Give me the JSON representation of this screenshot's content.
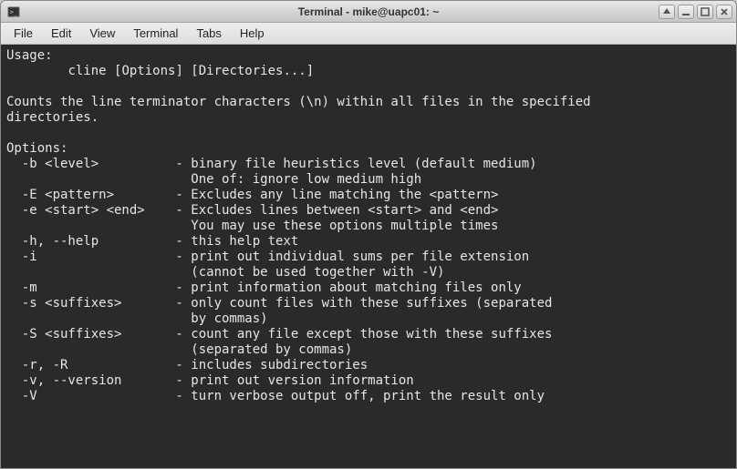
{
  "window": {
    "title": "Terminal - mike@uapc01: ~"
  },
  "menubar": {
    "items": [
      "File",
      "Edit",
      "View",
      "Terminal",
      "Tabs",
      "Help"
    ]
  },
  "terminal": {
    "lines": [
      "Usage:",
      "\tcline [Options] [Directories...]",
      "",
      "Counts the line terminator characters (\\n) within all files in the specified",
      "directories.",
      "",
      "Options:",
      "  -b <level>          - binary file heuristics level (default medium)",
      "                        One of: ignore low medium high",
      "  -E <pattern>        - Excludes any line matching the <pattern>",
      "  -e <start> <end>    - Excludes lines between <start> and <end>",
      "                        You may use these options multiple times",
      "  -h, --help          - this help text",
      "  -i                  - print out individual sums per file extension",
      "                        (cannot be used together with -V)",
      "  -m                  - print information about matching files only",
      "  -s <suffixes>       - only count files with these suffixes (separated",
      "                        by commas)",
      "  -S <suffixes>       - count any file except those with these suffixes",
      "                        (separated by commas)",
      "  -r, -R              - includes subdirectories",
      "  -v, --version       - print out version information",
      "  -V                  - turn verbose output off, print the result only"
    ]
  }
}
